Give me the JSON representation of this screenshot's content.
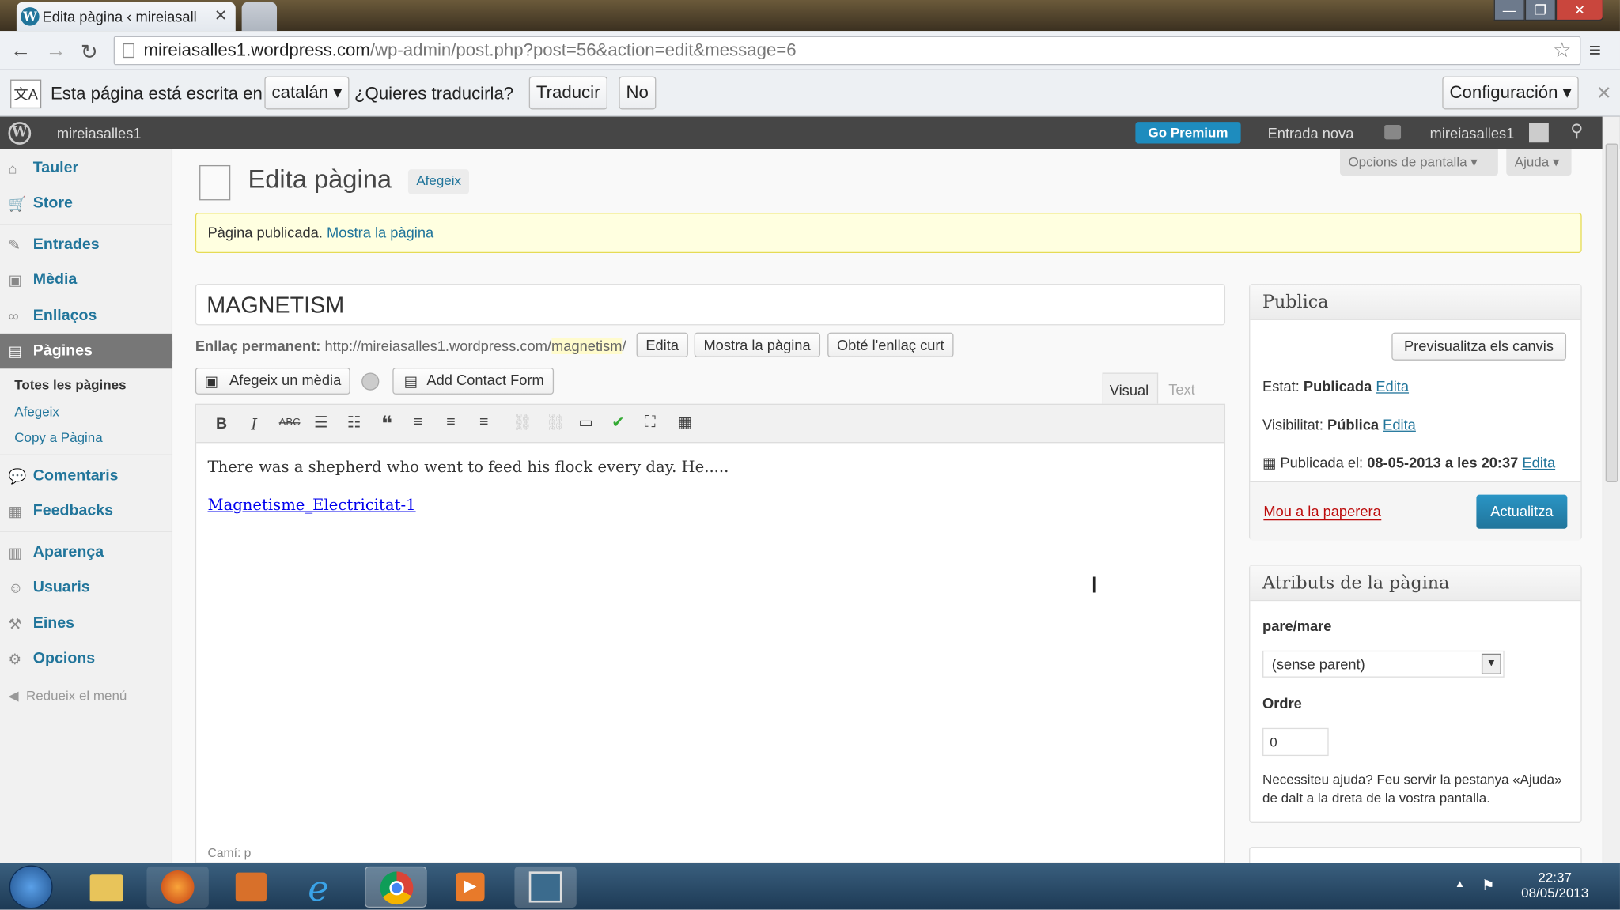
{
  "browser": {
    "tab_title": "Edita pàgina ‹ mireiasalles",
    "url_host": "mireiasalles1.wordpress.com",
    "url_path": "/wp-admin/post.php?post=56&action=edit&message=6"
  },
  "translate_bar": {
    "prefix": "Esta página está escrita en",
    "language": "catalán",
    "question": "¿Quieres traducirla?",
    "translate_btn": "Traducir",
    "no_btn": "No",
    "settings_btn": "Configuración"
  },
  "admin_bar": {
    "site": "mireiasalles1",
    "premium": "Go Premium",
    "new_post": "Entrada nova",
    "user": "mireiasalles1"
  },
  "sidebar": {
    "items": [
      {
        "label": "Tauler",
        "icon": "dashboard-icon"
      },
      {
        "label": "Store",
        "icon": "cart-icon"
      },
      {
        "label": "Entrades",
        "icon": "pin-icon"
      },
      {
        "label": "Mèdia",
        "icon": "media-icon"
      },
      {
        "label": "Enllaços",
        "icon": "link-icon"
      },
      {
        "label": "Pàgines",
        "icon": "pages-icon"
      },
      {
        "label": "Comentaris",
        "icon": "comment-icon"
      },
      {
        "label": "Feedbacks",
        "icon": "feedback-icon"
      },
      {
        "label": "Aparença",
        "icon": "appearance-icon"
      },
      {
        "label": "Usuaris",
        "icon": "users-icon"
      },
      {
        "label": "Eines",
        "icon": "tools-icon"
      },
      {
        "label": "Opcions",
        "icon": "settings-icon"
      }
    ],
    "submenu": [
      "Totes les pàgines",
      "Afegeix",
      "Copy a Pàgina"
    ],
    "collapse": "Redueix el menú"
  },
  "header": {
    "title": "Edita pàgina",
    "add_btn": "Afegeix",
    "screen_options": "Opcions de pantalla",
    "help": "Ajuda"
  },
  "notice": {
    "text": "Pàgina publicada.",
    "link": "Mostra la pàgina"
  },
  "editor": {
    "title_value": "MAGNETISM",
    "permalink_label": "Enllaç permanent:",
    "permalink_base": "http://mireiasalles1.wordpress.com/",
    "permalink_slug": "magnetism",
    "permalink_end": "/",
    "edit_btn": "Edita",
    "view_btn": "Mostra la pàgina",
    "shortlink_btn": "Obté l'enllaç curt",
    "add_media": "Afegeix un mèdia",
    "add_contact": "Add Contact Form",
    "tab_visual": "Visual",
    "tab_text": "Text",
    "body_text": "There was a shepherd who went to feed his flock every day. He.....",
    "body_link": "Magnetisme_Electricitat-1",
    "path": "Camí: p"
  },
  "publish": {
    "title": "Publica",
    "preview_btn": "Previsualitza els canvis",
    "status_label": "Estat:",
    "status_value": "Publicada",
    "visibility_label": "Visibilitat:",
    "visibility_value": "Pública",
    "published_label": "Publicada el:",
    "published_value": "08-05-2013 a les 20:37",
    "edit": "Edita",
    "trash": "Mou a la paperera",
    "update_btn": "Actualitza"
  },
  "attributes": {
    "title": "Atributs de la pàgina",
    "parent_label": "pare/mare",
    "parent_value": "(sense parent)",
    "order_label": "Ordre",
    "order_value": "0",
    "help": "Necessiteu ajuda? Feu servir la pestanya «Ajuda» de dalt a la dreta de la vostra pantalla."
  },
  "taskbar": {
    "time": "22:37",
    "date": "08/05/2013"
  }
}
